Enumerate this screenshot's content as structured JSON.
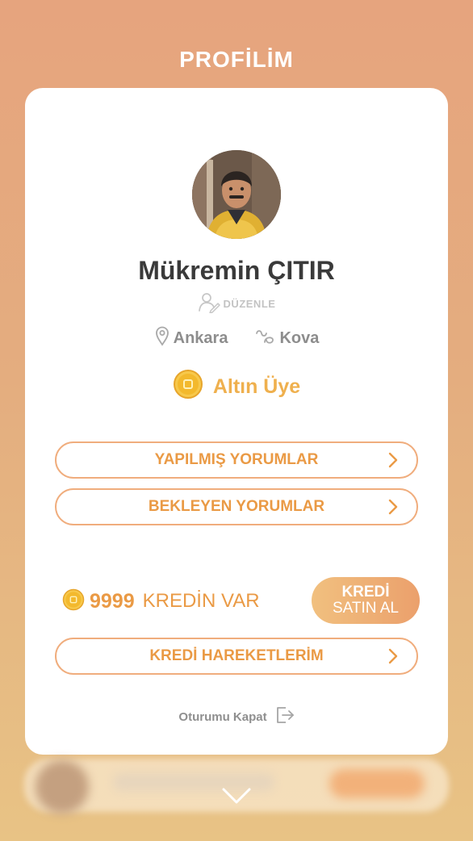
{
  "header": {
    "title": "PROFİLİM"
  },
  "profile": {
    "name": "Mükremin ÇITIR",
    "edit_label": "DÜZENLE",
    "city": "Ankara",
    "zodiac": "Kova",
    "membership": "Altın Üye"
  },
  "menu": {
    "done_reviews": "YAPILMIŞ YORUMLAR",
    "pending_reviews": "BEKLEYEN YORUMLAR",
    "credit_history": "KREDİ HAREKETLERİM"
  },
  "credit": {
    "amount": "9999",
    "text": "KREDİN VAR",
    "buy_top": "KREDİ",
    "buy_bottom": "SATIN AL"
  },
  "logout": {
    "label": "Oturumu Kapat"
  },
  "icons": {
    "avatar": "avatar",
    "edit": "user-edit-icon",
    "location": "location-pin-icon",
    "zodiac": "aquarius-icon",
    "gold_coin": "gold-coin-icon",
    "chevron_right": "chevron-right-icon",
    "logout": "logout-icon",
    "chevron_down": "chevron-down-icon"
  },
  "colors": {
    "accent": "#ea9a45",
    "gold": "#efb04e",
    "button_gradient_start": "#f1c07f",
    "button_gradient_end": "#eba06c",
    "background_top": "#e6a47e",
    "background_bottom": "#e8c385"
  }
}
